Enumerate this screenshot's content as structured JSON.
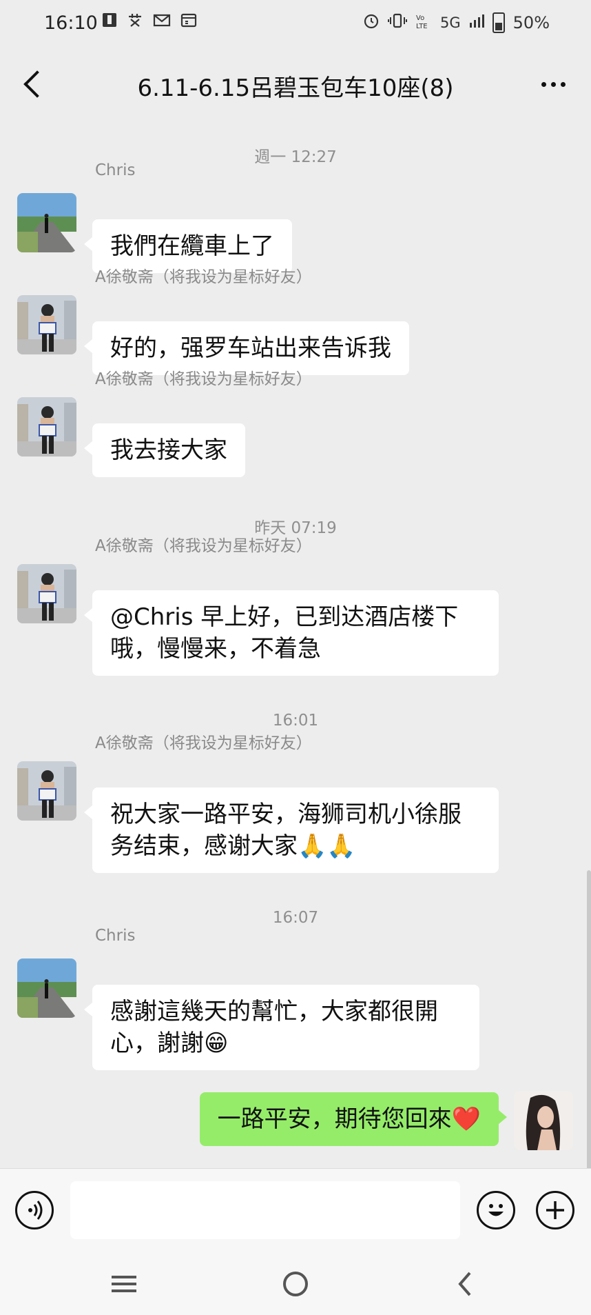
{
  "status_bar": {
    "time": "16:10",
    "left_icons": [
      "notification-square-icon",
      "sticker-icon",
      "mail-icon",
      "calendar-icon"
    ],
    "network": "5G",
    "battery": "50%"
  },
  "header": {
    "title": "6.11-6.15呂碧玉包车10座(8)",
    "back_icon": "chevron-left-icon",
    "more_icon": "more-dots-icon"
  },
  "messages": [
    {
      "type": "time",
      "text": "週一 12:27"
    },
    {
      "type": "msg",
      "side": "left",
      "sender": "Chris",
      "text": "我們在纜車上了"
    },
    {
      "type": "msg",
      "side": "left",
      "sender": "A徐敬斋（将我设为星标好友）",
      "text": "好的，强罗车站出来告诉我"
    },
    {
      "type": "msg",
      "side": "left",
      "sender": "A徐敬斋（将我设为星标好友）",
      "text": "我去接大家"
    },
    {
      "type": "time",
      "text": "昨天 07:19"
    },
    {
      "type": "msg",
      "side": "left",
      "sender": "A徐敬斋（将我设为星标好友）",
      "line1": "@Chris  早上好，已到达酒店楼下",
      "line2": "哦，慢慢来，不着急"
    },
    {
      "type": "time",
      "text": "16:01"
    },
    {
      "type": "msg",
      "side": "left",
      "sender": "A徐敬斋（将我设为星标好友）",
      "line1": "祝大家一路平安，海狮司机小徐服",
      "line2": "务结束，感谢大家",
      "emoji": "🙏🙏"
    },
    {
      "type": "time",
      "text": "16:07"
    },
    {
      "type": "msg",
      "side": "left",
      "sender": "Chris",
      "line1": "感謝這幾天的幫忙，大家都很開",
      "line2": "心，謝謝",
      "emoji": "😁"
    },
    {
      "type": "msg",
      "side": "right",
      "text": "一路平安，期待您回來",
      "emoji": "❤️"
    }
  ],
  "input_bar": {
    "voice_icon": "voice-icon",
    "text_value": "",
    "emoji_icon": "smiley-icon",
    "plus_icon": "plus-icon"
  },
  "nav_bar": [
    "menu-icon",
    "home-icon",
    "back-icon"
  ],
  "colors": {
    "background": "#ededed",
    "bubble_left": "#ffffff",
    "bubble_right": "#95ec69",
    "meta_text": "#8f8f8f"
  }
}
